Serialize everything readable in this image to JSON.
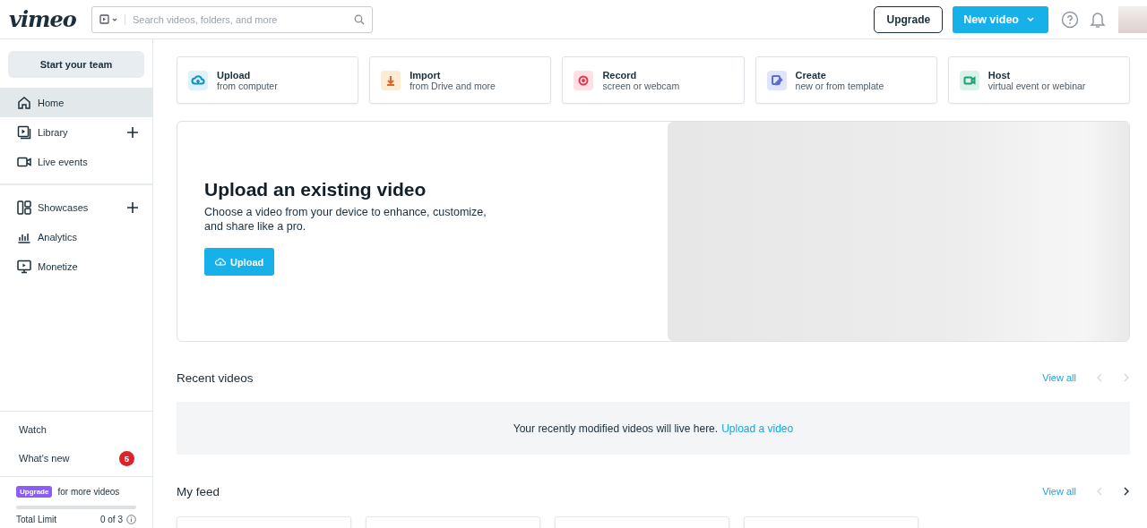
{
  "header": {
    "logo": "vimeo",
    "search": {
      "placeholder": "Search videos, folders, and more"
    },
    "upgrade": "Upgrade",
    "new_video": "New video"
  },
  "sidebar": {
    "team_button": "Start your team",
    "groups": [
      [
        {
          "label": "Home",
          "kind": "home",
          "selected": true,
          "add": false
        },
        {
          "label": "Library",
          "kind": "library",
          "selected": false,
          "add": true
        },
        {
          "label": "Live events",
          "kind": "camera",
          "selected": false,
          "add": false
        }
      ],
      [
        {
          "label": "Showcases",
          "kind": "showcase",
          "selected": false,
          "add": true
        },
        {
          "label": "Analytics",
          "kind": "chart",
          "selected": false,
          "add": false
        },
        {
          "label": "Monetize",
          "kind": "monitor",
          "selected": false,
          "add": false
        }
      ]
    ],
    "footer_links": [
      {
        "label": "Watch"
      },
      {
        "label": "What's new",
        "badge": "5"
      }
    ],
    "quota": {
      "badge": "Upgrade",
      "text": "for more videos",
      "level": 0,
      "label": "Total Limit",
      "count": "0 of 3"
    }
  },
  "actions": [
    {
      "title": "Upload",
      "subtitle": "from computer",
      "kind": "upload"
    },
    {
      "title": "Import",
      "subtitle": "from Drive and more",
      "kind": "import"
    },
    {
      "title": "Record",
      "subtitle": "screen or webcam",
      "kind": "record"
    },
    {
      "title": "Create",
      "subtitle": "new or from template",
      "kind": "create"
    },
    {
      "title": "Host",
      "subtitle": "virtual event or webinar",
      "kind": "host"
    }
  ],
  "hero": {
    "title": "Upload an existing video",
    "text": "Choose a video from your device to enhance, customize, and share like a pro.",
    "button": "Upload"
  },
  "recent": {
    "title": "Recent videos",
    "view_all": "View all",
    "prev_disabled": true,
    "next_disabled": true,
    "empty_text": "Your recently modified videos will live here.",
    "empty_link": "Upload a video"
  },
  "feed": {
    "title": "My feed",
    "view_all": "View all",
    "prev_disabled": true,
    "next_disabled": false
  }
}
